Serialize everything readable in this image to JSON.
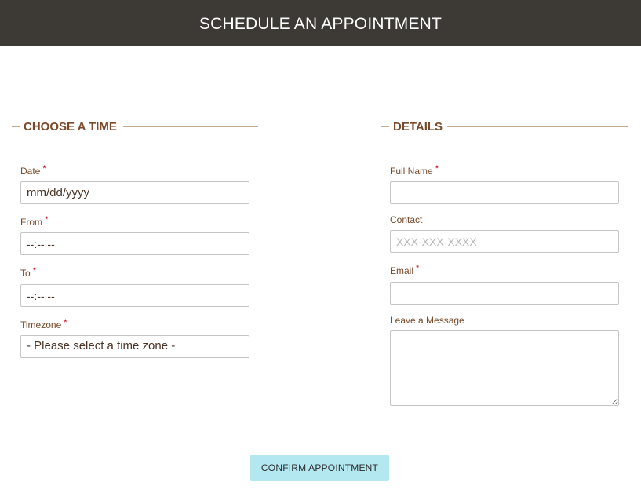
{
  "header": {
    "title": "SCHEDULE AN APPOINTMENT"
  },
  "time_section": {
    "title": "CHOOSE A TIME",
    "date": {
      "label": "Date",
      "required": "*",
      "value": "mm/dd/yyyy"
    },
    "from": {
      "label": "From",
      "required": "*",
      "value": "--:-- --"
    },
    "to": {
      "label": "To",
      "required": "*",
      "value": "--:-- --"
    },
    "timezone": {
      "label": "Timezone",
      "required": "*",
      "selected": "- Please select a time zone -"
    }
  },
  "details_section": {
    "title": "DETAILS",
    "full_name": {
      "label": "Full Name",
      "required": "*",
      "value": ""
    },
    "contact": {
      "label": "Contact",
      "placeholder": "XXX-XXX-XXXX"
    },
    "email": {
      "label": "Email",
      "required": "*",
      "value": ""
    },
    "message": {
      "label": "Leave a Message",
      "value": ""
    }
  },
  "confirm_button": {
    "label": "CONFIRM APPOINTMENT"
  },
  "colors": {
    "header_bg": "#3d3a36",
    "accent_brown": "#7a4a2b",
    "required": "#d0021b",
    "button_bg": "#b3e8f0"
  }
}
